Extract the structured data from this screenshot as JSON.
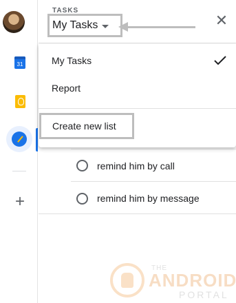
{
  "app": {
    "header_label": "TASKS",
    "list_selected": "My Tasks"
  },
  "rail": {
    "calendar_day": "31",
    "icons": [
      "avatar",
      "calendar-icon",
      "keep-icon",
      "tasks-icon",
      "add-icon"
    ],
    "add_glyph": "+"
  },
  "close_glyph": "✕",
  "menu": {
    "items": [
      {
        "label": "My Tasks",
        "selected": true
      },
      {
        "label": "Report",
        "selected": false
      }
    ],
    "create_label": "Create new list"
  },
  "tasks": [
    {
      "title": "remind him by call",
      "completed": false
    },
    {
      "title": "remind him by message",
      "completed": false
    }
  ],
  "watermark": {
    "line1": "THE",
    "line2": "ANDROID",
    "line3": "PORTAL"
  },
  "colors": {
    "accent": "#1a73e8",
    "annotation": "#bdbdbd",
    "keep": "#fbbc04"
  }
}
